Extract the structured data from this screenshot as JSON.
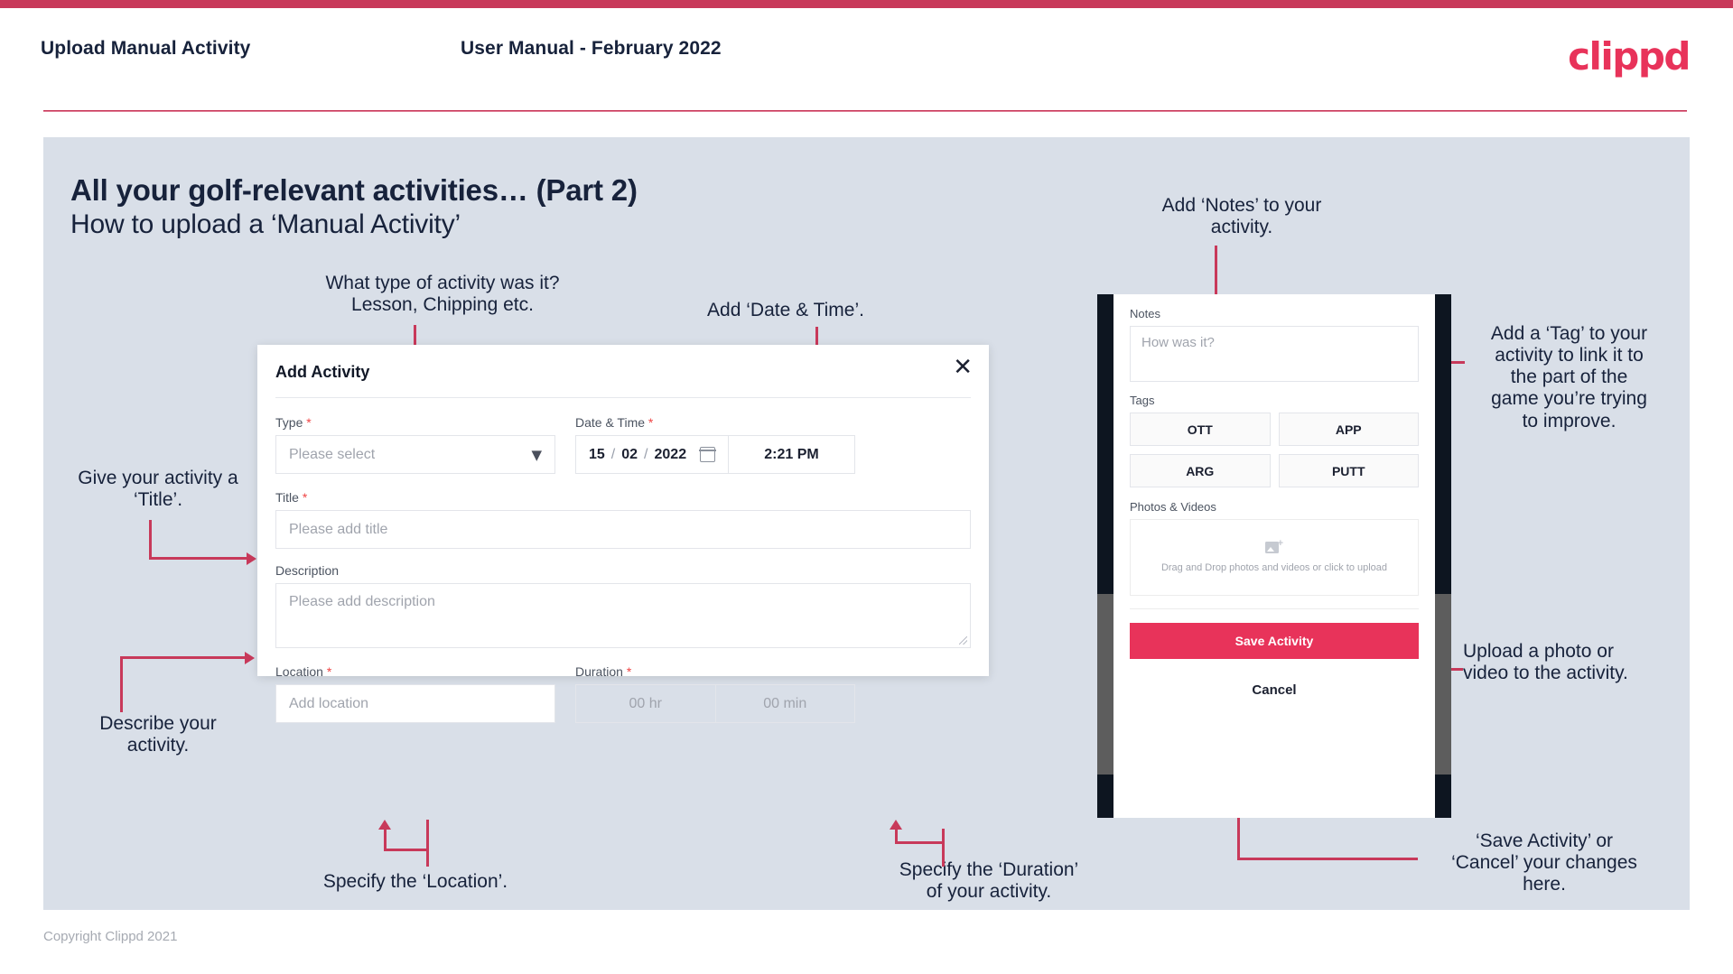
{
  "header": {
    "title": "Upload Manual Activity",
    "subtitle": "User Manual - February 2022",
    "logo": "clippd"
  },
  "slide": {
    "title": "All your golf-relevant activities… (Part 2)",
    "subtitle": "How to upload a ‘Manual Activity’"
  },
  "annotations": {
    "type": "What type of activity was it?\nLesson, Chipping etc.",
    "datetime": "Add ‘Date & Time’.",
    "title": "Give your activity a\n‘Title’.",
    "description": "Describe your\nactivity.",
    "location": "Specify the ‘Location’.",
    "duration": "Specify the ‘Duration’\nof your activity.",
    "notes": "Add ‘Notes’ to your\nactivity.",
    "tags": "Add a ‘Tag’ to your\nactivity to link it to\nthe part of the\ngame you’re trying\nto improve.",
    "upload": "Upload a photo or\nvideo to the activity.",
    "save": "‘Save Activity’ or\n‘Cancel’ your changes\nhere."
  },
  "dialog": {
    "title": "Add Activity",
    "close_icon": "close-icon",
    "fields": {
      "type": {
        "label": "Type",
        "required": "*",
        "placeholder": "Please select",
        "chevron_icon": "chevron-down-icon"
      },
      "datetime": {
        "label": "Date & Time",
        "required": "*",
        "day": "15",
        "month": "02",
        "year": "2022",
        "separator": "/",
        "calendar_icon": "calendar-icon",
        "time": "2:21 PM"
      },
      "title": {
        "label": "Title",
        "required": "*",
        "placeholder": "Please add title"
      },
      "description": {
        "label": "Description",
        "required": "",
        "placeholder": "Please add description"
      },
      "location": {
        "label": "Location",
        "required": "*",
        "placeholder": "Add location"
      },
      "duration": {
        "label": "Duration",
        "required": "*",
        "hours_placeholder": "00 hr",
        "minutes_placeholder": "00 min"
      }
    }
  },
  "phone": {
    "notes": {
      "label": "Notes",
      "placeholder": "How was it?"
    },
    "tags": {
      "label": "Tags",
      "items": [
        "OTT",
        "APP",
        "ARG",
        "PUTT"
      ]
    },
    "photos": {
      "label": "Photos & Videos",
      "icon": "add-image-icon",
      "drop_text": "Drag and Drop photos and videos or click to upload"
    },
    "save_label": "Save Activity",
    "cancel_label": "Cancel"
  },
  "footer": {
    "copyright": "Copyright Clippd 2021"
  },
  "colors": {
    "brand_pink": "#e8335a",
    "accent_crimson": "#c8395a",
    "slide_bg": "#d9dfe8",
    "ink": "#17223b"
  }
}
